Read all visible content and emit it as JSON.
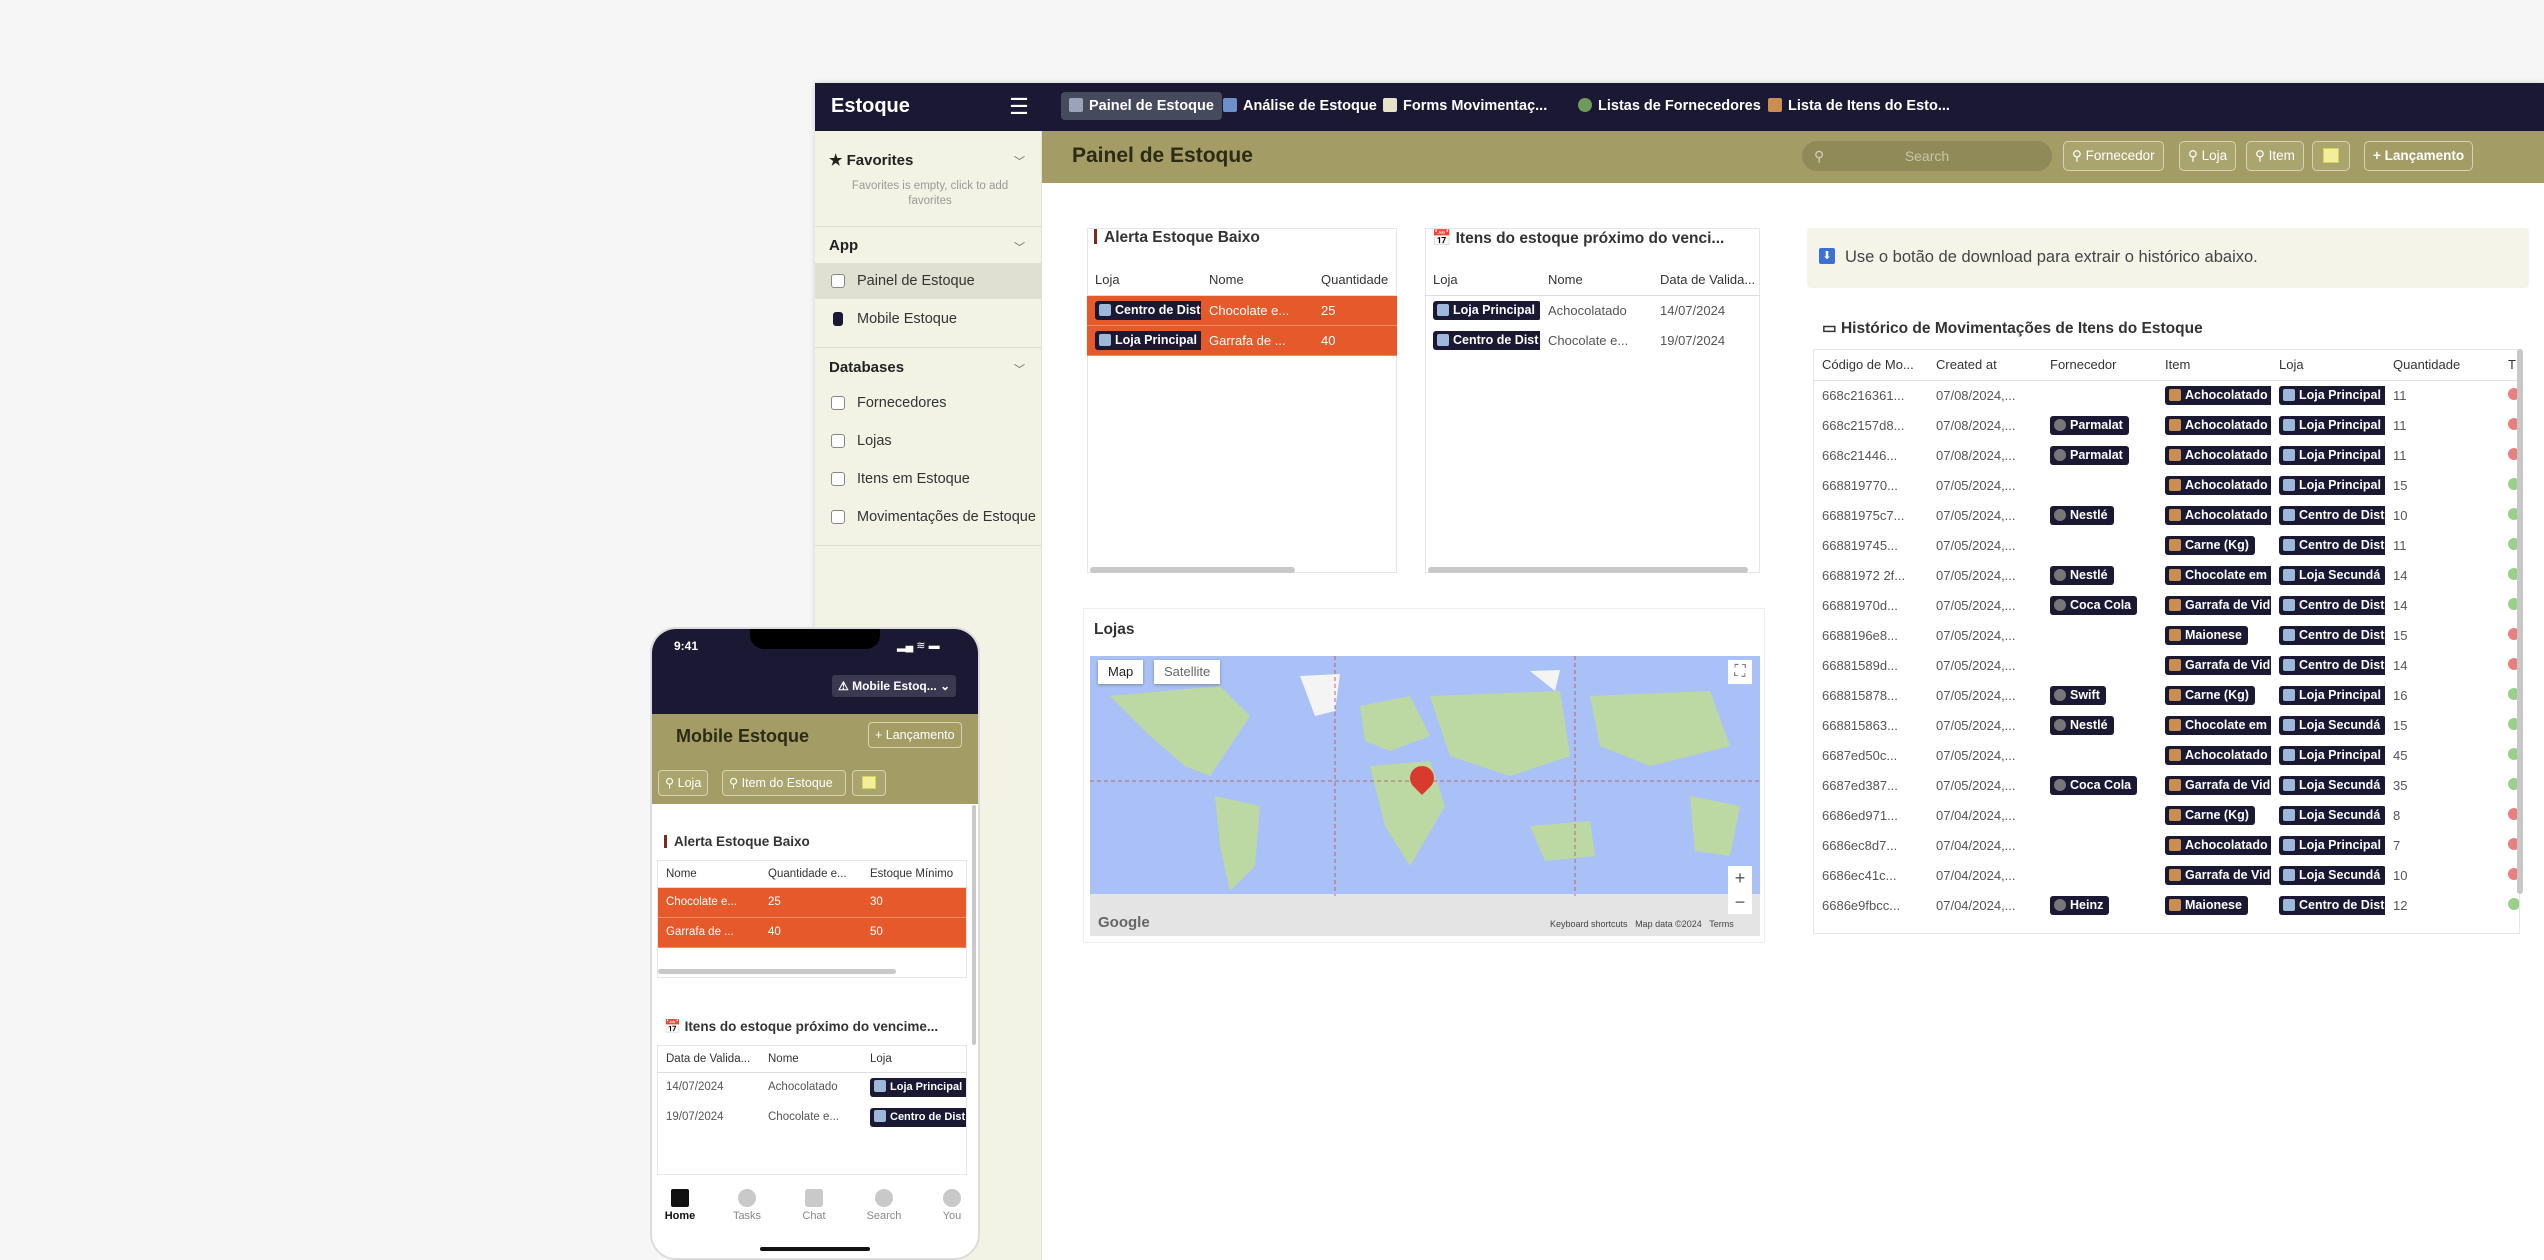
{
  "app": {
    "title": "Estoque",
    "menu_icon": "hamburger-icon",
    "tabs": [
      {
        "label": "Painel de Estoque",
        "icon": "dashboard-icon"
      },
      {
        "label": "Análise de Estoque",
        "icon": "chart-icon"
      },
      {
        "label": "Forms Movimentaç...",
        "icon": "form-icon"
      },
      {
        "label": "Listas de Fornecedores",
        "icon": "person-icon"
      },
      {
        "label": "Lista de Itens do Esto...",
        "icon": "box-icon"
      }
    ]
  },
  "sidebar": {
    "favorites": {
      "title": "Favorites",
      "empty": "Favorites is empty, click to add favorites"
    },
    "app_section": "App",
    "app_items": [
      "Painel de Estoque",
      "Mobile Estoque"
    ],
    "db_section": "Databases",
    "db_items": [
      "Fornecedores",
      "Lojas",
      "Itens em Estoque",
      "Movimentações de Estoque"
    ]
  },
  "header": {
    "title": "Painel de Estoque",
    "search_placeholder": "Search",
    "filters": [
      "Fornecedor",
      "Loja",
      "Item"
    ],
    "launch": "+ Lançamento"
  },
  "low_stock": {
    "title": "Alerta Estoque Baixo",
    "columns": [
      "Loja",
      "Nome",
      "Quantidade"
    ],
    "rows": [
      [
        "Centro de Dist",
        "Chocolate e...",
        "25"
      ],
      [
        "Loja Principal",
        "Garrafa de ...",
        "40"
      ]
    ]
  },
  "expiring": {
    "title": "Itens do estoque próximo do venci...",
    "columns": [
      "Loja",
      "Nome",
      "Data de Valida..."
    ],
    "rows": [
      [
        "Loja Principal",
        "Achocolatado",
        "14/07/2024"
      ],
      [
        "Centro de Dist",
        "Chocolate e...",
        "19/07/2024"
      ]
    ]
  },
  "info": {
    "text": "Use o botão de download para extrair o histórico abaixo."
  },
  "history": {
    "title": "Histórico de Movimentações de Itens do Estoque",
    "columns": [
      "Código de Mo...",
      "Created at",
      "Fornecedor",
      "Item",
      "Loja",
      "Quantidade",
      "T"
    ],
    "rows": [
      [
        "668c216361...",
        "07/08/2024,...",
        "",
        "Achocolatado",
        "Loja Principal",
        "11",
        "r"
      ],
      [
        "668c2157d8...",
        "07/08/2024,...",
        "Parmalat",
        "Achocolatado",
        "Loja Principal",
        "11",
        "r"
      ],
      [
        "668c21446...",
        "07/08/2024,...",
        "Parmalat",
        "Achocolatado",
        "Loja Principal",
        "11",
        "r"
      ],
      [
        "668819770...",
        "07/05/2024,...",
        "",
        "Achocolatado",
        "Loja Principal",
        "15",
        "g"
      ],
      [
        "66881975c7...",
        "07/05/2024,...",
        "Nestlé",
        "Achocolatado",
        "Centro de Dist",
        "10",
        "g"
      ],
      [
        "668819745...",
        "07/05/2024,...",
        "",
        "Carne (Kg)",
        "Centro de Dist",
        "11",
        "g"
      ],
      [
        "66881972 2f...",
        "07/05/2024,...",
        "Nestlé",
        "Chocolate em",
        "Loja Secundá",
        "14",
        "g"
      ],
      [
        "66881970d...",
        "07/05/2024,...",
        "Coca Cola",
        "Garrafa de Vid",
        "Centro de Dist",
        "14",
        "g"
      ],
      [
        "6688196e8...",
        "07/05/2024,...",
        "",
        "Maionese",
        "Centro de Dist",
        "15",
        "r"
      ],
      [
        "66881589d...",
        "07/05/2024,...",
        "",
        "Garrafa de Vid",
        "Centro de Dist",
        "14",
        "r"
      ],
      [
        "668815878...",
        "07/05/2024,...",
        "Swift",
        "Carne (Kg)",
        "Loja Principal",
        "16",
        "g"
      ],
      [
        "668815863...",
        "07/05/2024,...",
        "Nestlé",
        "Chocolate em",
        "Loja Secundá",
        "15",
        "g"
      ],
      [
        "6687ed50c...",
        "07/05/2024,...",
        "",
        "Achocolatado",
        "Loja Principal",
        "45",
        "g"
      ],
      [
        "6687ed387...",
        "07/05/2024,...",
        "Coca Cola",
        "Garrafa de Vid",
        "Loja Secundá",
        "35",
        "g"
      ],
      [
        "6686ed971...",
        "07/04/2024,...",
        "",
        "Carne (Kg)",
        "Loja Secundá",
        "8",
        "r"
      ],
      [
        "6686ec8d7...",
        "07/04/2024,...",
        "",
        "Achocolatado",
        "Loja Principal",
        "7",
        "r"
      ],
      [
        "6686ec41c...",
        "07/04/2024,...",
        "",
        "Garrafa de Vid",
        "Loja Secundá",
        "10",
        "r"
      ],
      [
        "6686e9fbcc...",
        "07/04/2024,...",
        "Heinz",
        "Maionese",
        "Centro de Dist",
        "12",
        "g"
      ]
    ]
  },
  "lojas": {
    "title": "Lojas",
    "map_tab": "Map",
    "satellite_tab": "Satellite",
    "google": "Google",
    "footer": [
      "Keyboard shortcuts",
      "Map data ©2024",
      "Terms"
    ]
  },
  "phone": {
    "time": "9:41",
    "app_switch": "Mobile Estoq...",
    "title": "Mobile Estoque",
    "launch": "+ Lançamento",
    "filters": [
      "Loja",
      "Item do Estoque"
    ],
    "low_stock": {
      "title": "Alerta Estoque Baixo",
      "columns": [
        "Nome",
        "Quantidade e...",
        "Estoque Mínimo"
      ],
      "rows": [
        [
          "Chocolate e...",
          "25",
          "30"
        ],
        [
          "Garrafa de ...",
          "40",
          "50"
        ]
      ]
    },
    "expiring": {
      "title": "Itens do estoque próximo do vencime...",
      "columns": [
        "Data de Valida...",
        "Nome",
        "Loja"
      ],
      "rows": [
        [
          "14/07/2024",
          "Achocolatado",
          "Loja Principal"
        ],
        [
          "19/07/2024",
          "Chocolate e...",
          "Centro de Dist"
        ]
      ]
    },
    "nav": [
      "Home",
      "Tasks",
      "Chat",
      "Search",
      "You"
    ]
  },
  "colors": {
    "topbar": "#1b1833",
    "header": "#a39d65",
    "alert": "#e5592a",
    "sidebar": "#f2f3e4"
  }
}
